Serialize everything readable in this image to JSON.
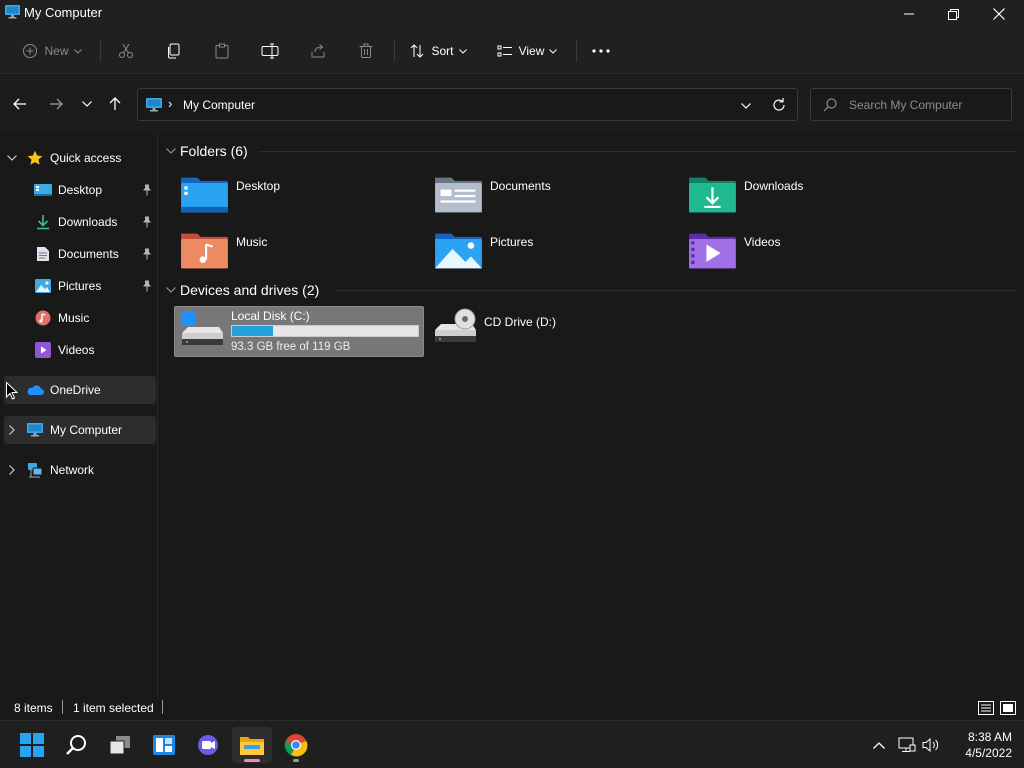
{
  "window": {
    "title": "My Computer",
    "controls": [
      "minimize",
      "restore",
      "close"
    ]
  },
  "toolbar": {
    "new_label": "New",
    "sort_label": "Sort",
    "view_label": "View",
    "icons": [
      "new-icon",
      "cut-icon",
      "copy-icon",
      "paste-icon",
      "rename-icon",
      "share-icon",
      "delete-icon",
      "sort-icon",
      "view-icon",
      "more-icon"
    ]
  },
  "address": {
    "crumb": "My Computer",
    "search_placeholder": "Search My Computer"
  },
  "sidebar": {
    "quick_access": "Quick access",
    "items": [
      {
        "label": "Desktop",
        "icon": "desktop-icon",
        "pinned": true
      },
      {
        "label": "Downloads",
        "icon": "downloads-icon",
        "pinned": true
      },
      {
        "label": "Documents",
        "icon": "documents-icon",
        "pinned": true
      },
      {
        "label": "Pictures",
        "icon": "pictures-icon",
        "pinned": true
      },
      {
        "label": "Music",
        "icon": "music-icon",
        "pinned": false
      },
      {
        "label": "Videos",
        "icon": "videos-icon",
        "pinned": false
      }
    ],
    "onedrive": "OneDrive",
    "my_computer": "My Computer",
    "network": "Network"
  },
  "content": {
    "folders_header": "Folders (6)",
    "folders": [
      {
        "name": "Desktop",
        "icon": "desktop-folder-icon"
      },
      {
        "name": "Documents",
        "icon": "documents-folder-icon"
      },
      {
        "name": "Downloads",
        "icon": "downloads-folder-icon"
      },
      {
        "name": "Music",
        "icon": "music-folder-icon"
      },
      {
        "name": "Pictures",
        "icon": "pictures-folder-icon"
      },
      {
        "name": "Videos",
        "icon": "videos-folder-icon"
      }
    ],
    "devices_header": "Devices and drives (2)",
    "drives": [
      {
        "name": "Local Disk (C:)",
        "free_text": "93.3 GB free of 119 GB",
        "used_fraction": 0.22,
        "selected": true,
        "icon": "hard-drive-icon"
      },
      {
        "name": "CD Drive (D:)",
        "icon": "cd-drive-icon",
        "selected": false
      }
    ]
  },
  "status": {
    "items_count": "8 items",
    "selected": "1 item selected"
  },
  "taskbar": {
    "apps": [
      "start-icon",
      "search-icon",
      "task-view-icon",
      "widgets-icon",
      "chat-icon",
      "file-explorer-icon",
      "chrome-icon"
    ],
    "time": "8:38 AM",
    "date": "4/5/2022"
  },
  "colors": {
    "accent": "#26a0da",
    "background": "#191919",
    "selection": "#777777"
  }
}
